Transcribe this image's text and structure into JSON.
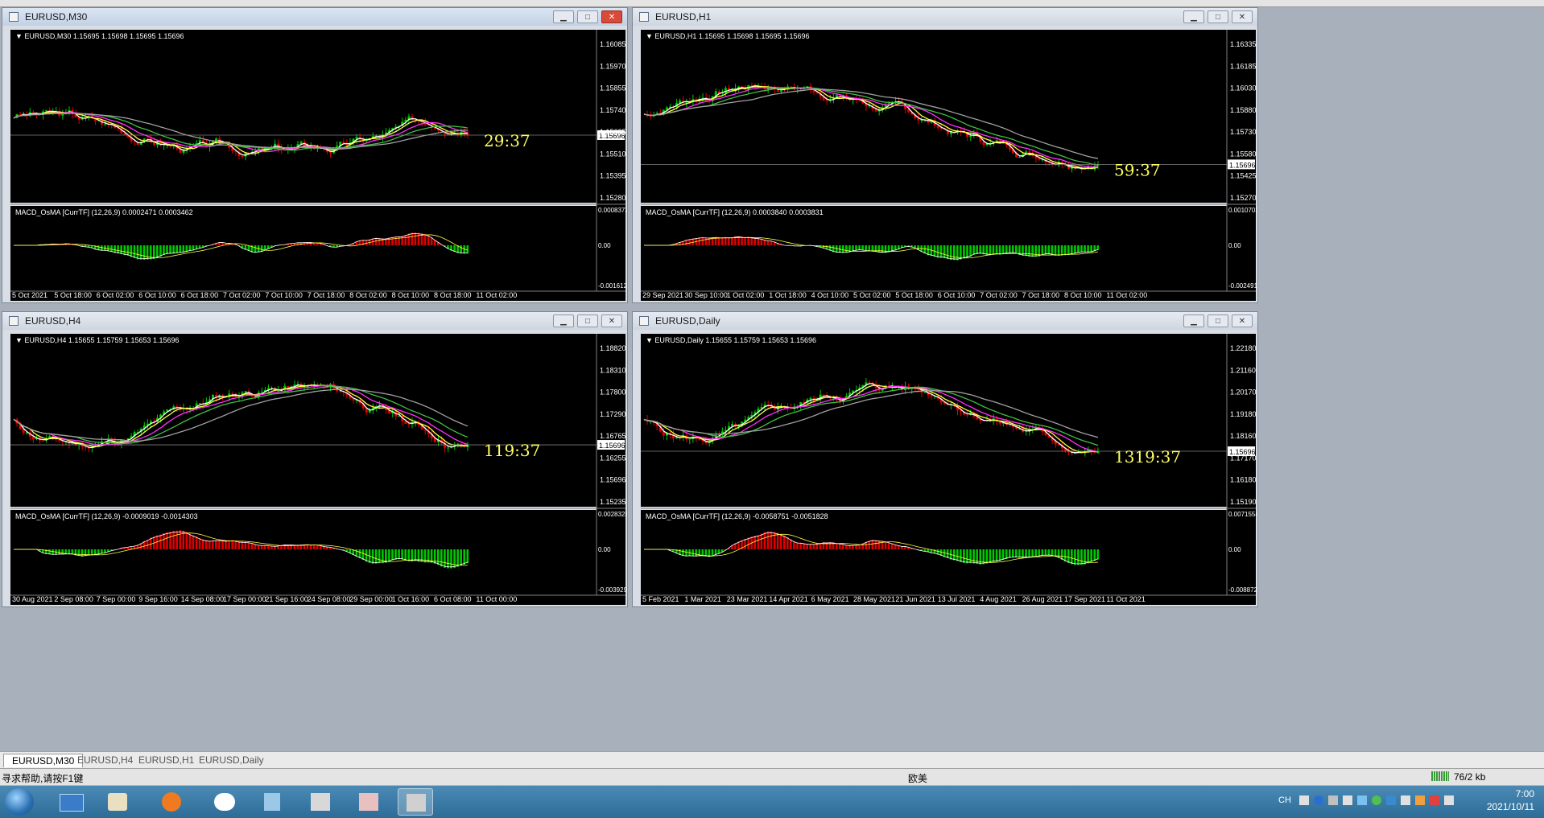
{
  "tabs": [
    "EURUSD,M30",
    "EURUSD,H4",
    "EURUSD,H1",
    "EURUSD,Daily"
  ],
  "status": {
    "help": "寻求帮助,请按F1键",
    "profile": "欧美",
    "traffic": "76/2 kb"
  },
  "clock": {
    "time": "7:00",
    "date": "2021/10/11"
  },
  "tray": {
    "lang": "CH"
  },
  "windows": [
    {
      "title": "EURUSD,M30",
      "info": "EURUSD,M30  1.15695 1.15698 1.15695 1.15696",
      "price_label": "1.15696",
      "timer": "29:37",
      "prices": [
        "1.16085",
        "1.15970",
        "1.15855",
        "1.15740",
        "1.15625",
        "1.15510",
        "1.15395",
        "1.15280"
      ],
      "macd_label": "MACD_OsMA [CurrTF] (12,26,9) 0.0002471 0.0003462",
      "macd_scale": [
        "0.0008372",
        "0.00",
        "-0.001612"
      ],
      "dates": [
        "5 Oct 2021",
        "5 Oct 18:00",
        "6 Oct 02:00",
        "6 Oct 10:00",
        "6 Oct 18:00",
        "7 Oct 02:00",
        "7 Oct 10:00",
        "7 Oct 18:00",
        "8 Oct 02:00",
        "8 Oct 10:00",
        "8 Oct 18:00",
        "11 Oct 02:00"
      ],
      "seed": 3
    },
    {
      "title": "EURUSD,H1",
      "info": "EURUSD,H1  1.15695 1.15698 1.15695 1.15696",
      "price_label": "1.15696",
      "timer": "59:37",
      "prices": [
        "1.16335",
        "1.16185",
        "1.16030",
        "1.15880",
        "1.15730",
        "1.15580",
        "1.15425",
        "1.15270"
      ],
      "macd_label": "MACD_OsMA [CurrTF] (12,26,9) 0.0003840 0.0003831",
      "macd_scale": [
        "0.0010703",
        "0.00",
        "-0.0024910"
      ],
      "dates": [
        "29 Sep 2021",
        "30 Sep 10:00",
        "1 Oct 02:00",
        "1 Oct 18:00",
        "4 Oct 10:00",
        "5 Oct 02:00",
        "5 Oct 18:00",
        "6 Oct 10:00",
        "7 Oct 02:00",
        "7 Oct 18:00",
        "8 Oct 10:00",
        "11 Oct 02:00"
      ],
      "seed": 7
    },
    {
      "title": "EURUSD,H4",
      "info": "EURUSD,H4  1.15655 1.15759 1.15653 1.15696",
      "price_label": "1.15696",
      "timer": "119:37",
      "prices": [
        "1.18820",
        "1.18310",
        "1.17800",
        "1.17290",
        "1.16765",
        "1.16255",
        "1.15696",
        "1.15235"
      ],
      "macd_label": "MACD_OsMA [CurrTF] (12,26,9) -0.0009019 -0.0014303",
      "macd_scale": [
        "0.0028328",
        "0.00",
        "-0.003929"
      ],
      "dates": [
        "30 Aug 2021",
        "2 Sep 08:00",
        "7 Sep 00:00",
        "9 Sep 16:00",
        "14 Sep 08:00",
        "17 Sep 00:00",
        "21 Sep 16:00",
        "24 Sep 08:00",
        "29 Sep 00:00",
        "1 Oct 16:00",
        "6 Oct 08:00",
        "11 Oct 00:00"
      ],
      "seed": 11
    },
    {
      "title": "EURUSD,Daily",
      "info": "EURUSD,Daily  1.15655 1.15759 1.15653 1.15696",
      "price_label": "1.15696",
      "timer": "1319:37",
      "prices": [
        "1.22180",
        "1.21160",
        "1.20170",
        "1.19180",
        "1.18160",
        "1.17170",
        "1.16180",
        "1.15190"
      ],
      "macd_label": "MACD_OsMA [CurrTF] (12,26,9) -0.0058751 -0.0051828",
      "macd_scale": [
        "0.0071554",
        "0.00",
        "-0.008872"
      ],
      "dates": [
        "5 Feb 2021",
        "1 Mar 2021",
        "23 Mar 2021",
        "14 Apr 2021",
        "6 May 2021",
        "28 May 2021",
        "21 Jun 2021",
        "13 Jul 2021",
        "4 Aug 2021",
        "26 Aug 2021",
        "17 Sep 2021",
        "11 Oct 2021"
      ],
      "seed": 5
    }
  ],
  "colors": {
    "bull": "#00c800",
    "bear": "#e00000",
    "ma_fast": "#ffffff",
    "ma_yellow": "#ffff40",
    "ma_magenta": "#ff30ff",
    "ma_green": "#40c040",
    "ma_gray": "#a0a0a0",
    "timer": "#ffff60"
  }
}
